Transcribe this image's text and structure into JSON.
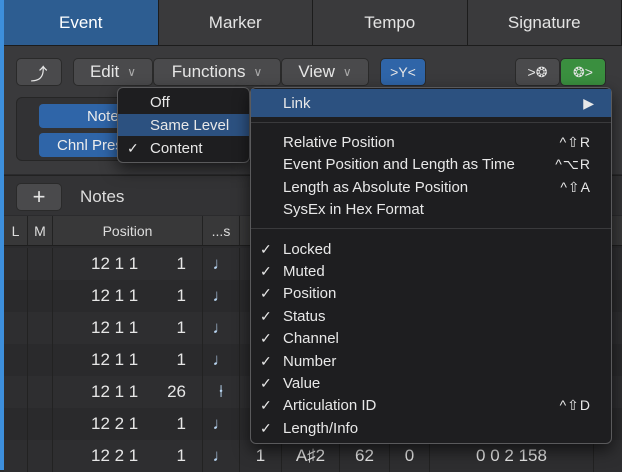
{
  "tabs": [
    "Event",
    "Marker",
    "Tempo",
    "Signature"
  ],
  "toolbar": {
    "back_icon": "curved-arrow-up-icon",
    "edit": "Edit",
    "functions": "Functions",
    "view": "View",
    "filter_icon": "filter-icon",
    "midi_out_icon": "midi-out-icon",
    "midi_in_icon": "midi-in-icon"
  },
  "filters": {
    "notes": "Notes",
    "chnl_press": "Chnl Press"
  },
  "list": {
    "add": "+",
    "title": "Notes"
  },
  "columns": {
    "l": "L",
    "m": "M",
    "position": "Position",
    "s": "...s"
  },
  "rows": [
    {
      "pos": "12 1 1",
      "tick": "1",
      "sym": "♩"
    },
    {
      "pos": "12 1 1",
      "tick": "1",
      "sym": "♩"
    },
    {
      "pos": "12 1 1",
      "tick": "1",
      "sym": "♩"
    },
    {
      "pos": "12 1 1",
      "tick": "1",
      "sym": "♩"
    },
    {
      "pos": "12 1 1",
      "tick": "26",
      "sym": "⍿"
    },
    {
      "pos": "12 2 1",
      "tick": "1",
      "sym": "♩"
    },
    {
      "pos": "12 2 1",
      "tick": "1",
      "sym": "♩",
      "ch": "1",
      "num": "A♯2",
      "val": "62",
      "art": "0",
      "len": "0 0 2 158"
    }
  ],
  "link_submenu": {
    "items": [
      {
        "label": "Off",
        "checked": false
      },
      {
        "label": "Same Level",
        "checked": false,
        "highlighted": true
      },
      {
        "label": "Content",
        "checked": true
      }
    ]
  },
  "view_menu": {
    "link": "Link",
    "group1": [
      {
        "label": "Relative Position",
        "shortcut": "^⇧R"
      },
      {
        "label": "Event Position and Length as Time",
        "shortcut": "^⌥R"
      },
      {
        "label": "Length as Absolute Position",
        "shortcut": "^⇧A"
      },
      {
        "label": "SysEx in Hex Format",
        "shortcut": ""
      }
    ],
    "group2": [
      {
        "label": "Locked",
        "shortcut": ""
      },
      {
        "label": "Muted",
        "shortcut": ""
      },
      {
        "label": "Position",
        "shortcut": ""
      },
      {
        "label": "Status",
        "shortcut": ""
      },
      {
        "label": "Channel",
        "shortcut": ""
      },
      {
        "label": "Number",
        "shortcut": ""
      },
      {
        "label": "Value",
        "shortcut": ""
      },
      {
        "label": "Articulation ID",
        "shortcut": "^⇧D"
      },
      {
        "label": "Length/Info",
        "shortcut": ""
      }
    ],
    "check": "✓"
  },
  "colors": {
    "accent": "#2d5d91",
    "green": "#3a8f3f"
  }
}
